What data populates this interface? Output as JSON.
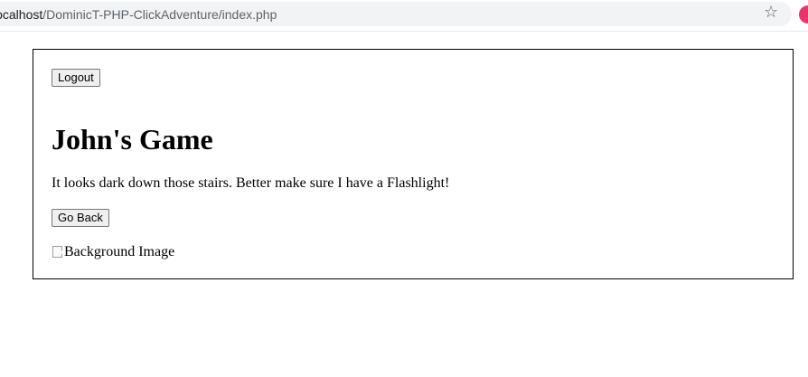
{
  "browser": {
    "url_host": "localhost",
    "url_path": "/DominicT-PHP-ClickAdventure/index.php",
    "star_icon": "star-icon",
    "profile_icon": "avatar"
  },
  "game": {
    "logout_label": "Logout",
    "title": "John's Game",
    "story_text": "It looks dark down those stairs. Better make sure I have a Flashlight!",
    "go_back_label": "Go Back",
    "background_image_alt": "Background Image"
  },
  "colors": {
    "avatar": "#e8336d",
    "border": "#000000",
    "url_bar": "#f1f3f4"
  }
}
